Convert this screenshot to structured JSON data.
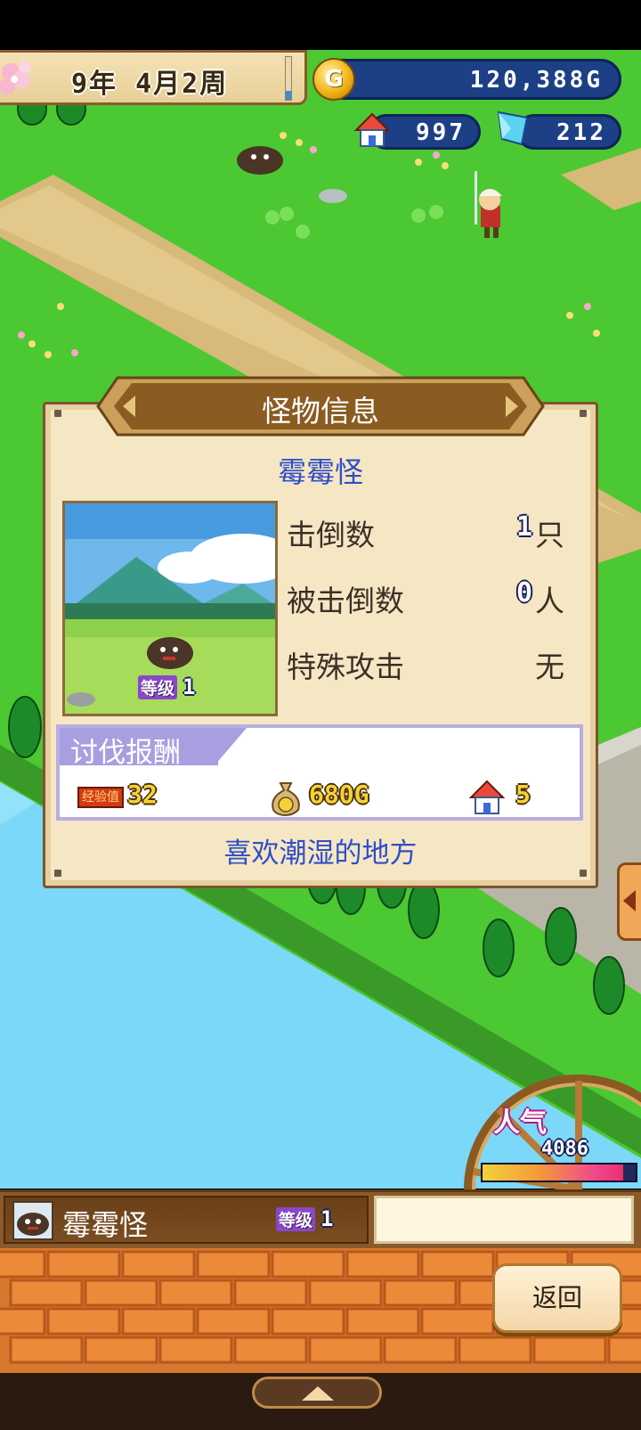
{
  "hud": {
    "date": "9年 4月2周",
    "week_progress": 0.2,
    "gold": "120,388G",
    "town": "997",
    "crystal": "212"
  },
  "dialog": {
    "title": "怪物信息",
    "monster_name": "霉霉怪",
    "level_label": "等级",
    "level": "1",
    "stats": [
      {
        "label": "击倒数",
        "value": "1",
        "unit": "只"
      },
      {
        "label": "被击倒数",
        "value": "0",
        "unit": "人"
      },
      {
        "label": "特殊攻击",
        "value": "无"
      }
    ],
    "reward_title": "讨伐报酬",
    "rewards": {
      "exp_label": "经验值",
      "exp": "32",
      "gold": "680G",
      "town": "5"
    },
    "flavor_text": "喜欢潮湿的地方"
  },
  "popularity": {
    "label": "人气",
    "value": "4086",
    "bar_fill": 0.92
  },
  "infobar": {
    "monster_name": "霉霉怪",
    "level_label": "等级",
    "level": "1"
  },
  "buttons": {
    "return": "返回"
  },
  "colors": {
    "accent_blue": "#2f4ec8",
    "hud_navy": "#1c3f86",
    "reward_purple": "#a99ee0",
    "grass": "#4cc832",
    "water": "#7cd8f8"
  }
}
